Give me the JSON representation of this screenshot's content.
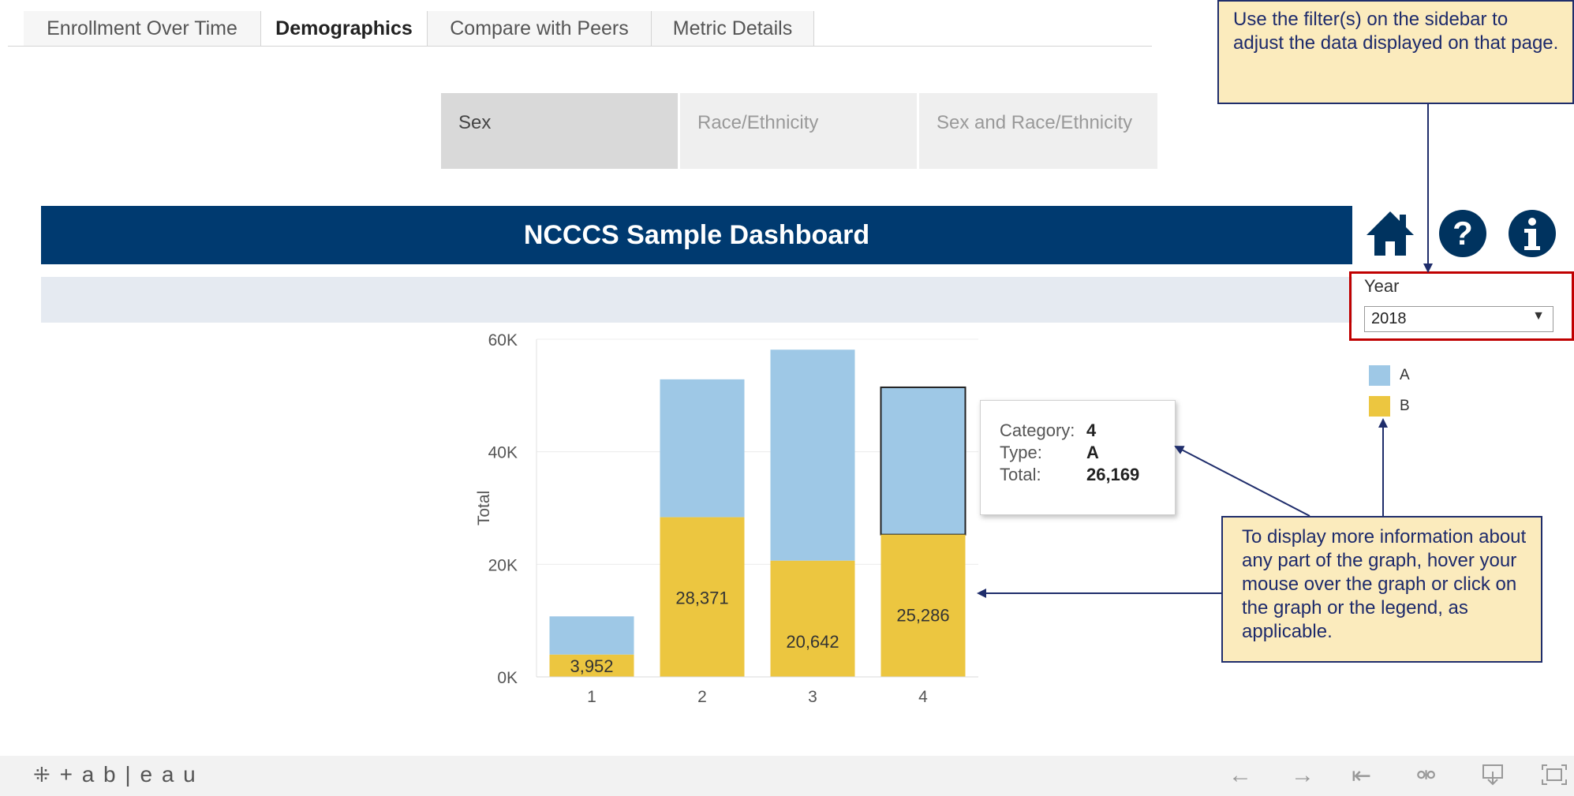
{
  "tabs": [
    {
      "label": "Enrollment Over Time",
      "active": false
    },
    {
      "label": "Demographics",
      "active": true
    },
    {
      "label": "Compare with Peers",
      "active": false
    },
    {
      "label": "Metric Details",
      "active": false
    }
  ],
  "subtabs": [
    {
      "label": "Sex",
      "active": true
    },
    {
      "label": "Race/Ethnicity",
      "active": false
    },
    {
      "label": "Sex and Race/Ethnicity",
      "active": false
    }
  ],
  "banner": {
    "title": "NCCCS Sample Dashboard"
  },
  "filter": {
    "label": "Year",
    "value": "2018"
  },
  "legend": [
    {
      "label": "A",
      "color": "#9ec8e6"
    },
    {
      "label": "B",
      "color": "#ecc640"
    }
  ],
  "callouts": {
    "filter_note": "Use the filter(s) on the sidebar to adjust the data displayed on that page.",
    "hover_note": "To display more information about any part of the graph, hover your mouse over the graph or click on the graph or the legend, as applicable."
  },
  "tooltip": {
    "category_label": "Category:",
    "category_value": "4",
    "type_label": "Type:",
    "type_value": "A",
    "total_label": "Total:",
    "total_value": "26,169"
  },
  "chart_data": {
    "type": "bar",
    "stacked": true,
    "categories": [
      "1",
      "2",
      "3",
      "4"
    ],
    "series": [
      {
        "name": "B",
        "values": [
          3952,
          28371,
          20642,
          25286
        ],
        "labels": [
          "3,952",
          "28,371",
          "20,642",
          "25,286"
        ]
      },
      {
        "name": "A",
        "values": [
          6800,
          24500,
          37500,
          26169
        ]
      }
    ],
    "ylabel": "Total",
    "ylim": [
      0,
      60000
    ],
    "yticks": [
      {
        "value": 0,
        "label": "0K"
      },
      {
        "value": 20000,
        "label": "20K"
      },
      {
        "value": 40000,
        "label": "40K"
      },
      {
        "value": 60000,
        "label": "60K"
      }
    ],
    "highlighted": {
      "category": "4",
      "series": "A"
    },
    "grid": true
  },
  "footer": {
    "logo_text": "+ a b | e a u",
    "nav_icons": [
      "back-icon",
      "forward-icon",
      "first-icon",
      "share-icon",
      "download-icon",
      "fullscreen-icon"
    ]
  }
}
